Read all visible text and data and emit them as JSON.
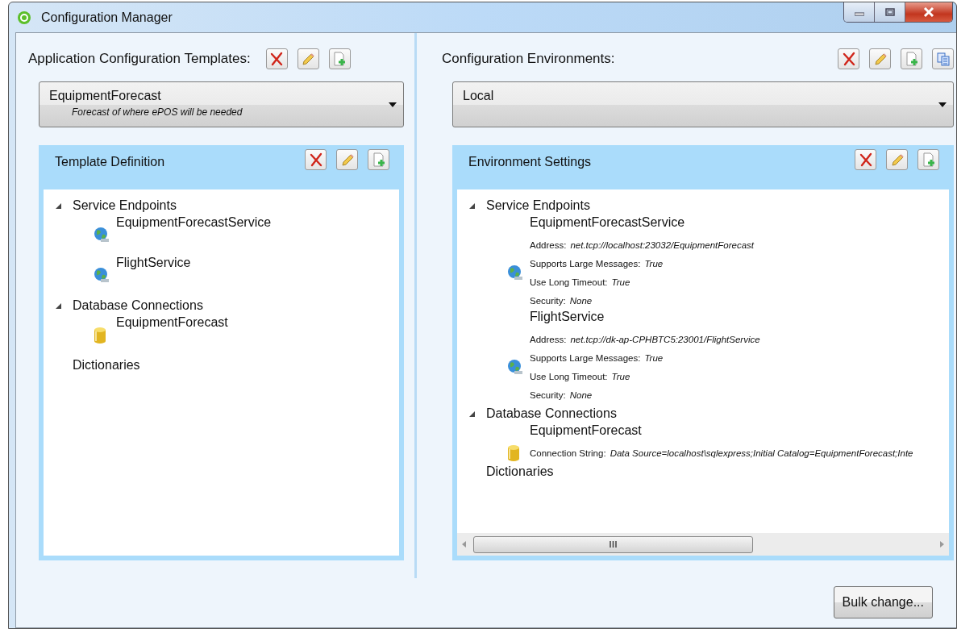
{
  "window": {
    "title": "Configuration Manager"
  },
  "templates": {
    "label": "Application Configuration Templates:",
    "actions": [
      {
        "kind": "delete"
      },
      {
        "kind": "edit"
      },
      {
        "kind": "add"
      }
    ],
    "dropdown": {
      "value": "EquipmentForecast",
      "description": "Forecast of where ePOS will be needed"
    },
    "panel": {
      "title": "Template Definition",
      "actions": [
        {
          "kind": "delete"
        },
        {
          "kind": "edit"
        },
        {
          "kind": "add"
        }
      ],
      "tree": [
        {
          "label": "Service Endpoints",
          "kind": "folder",
          "expanded": true,
          "children": [
            {
              "label": "EquipmentForecastService",
              "kind": "service"
            },
            {
              "label": "FlightService",
              "kind": "service"
            }
          ]
        },
        {
          "label": "Database Connections",
          "kind": "folder",
          "expanded": true,
          "children": [
            {
              "label": "EquipmentForecast",
              "kind": "database"
            }
          ]
        },
        {
          "label": "Dictionaries",
          "kind": "empty"
        }
      ]
    }
  },
  "environments": {
    "label": "Configuration Environments:",
    "actions": [
      {
        "kind": "delete"
      },
      {
        "kind": "edit"
      },
      {
        "kind": "add"
      },
      {
        "kind": "copy"
      }
    ],
    "dropdown": {
      "value": "Local"
    },
    "panel": {
      "title": "Environment Settings",
      "actions": [
        {
          "kind": "delete"
        },
        {
          "kind": "edit"
        },
        {
          "kind": "add"
        }
      ],
      "tree": [
        {
          "label": "Service Endpoints",
          "kind": "folder",
          "expanded": true,
          "children": [
            {
              "label": "EquipmentForecastService",
              "kind": "service",
              "properties": [
                {
                  "label": "Address:",
                  "value": "net.tcp://localhost:23032/EquipmentForecast"
                },
                {
                  "label": "Supports Large Messages:",
                  "value": "True"
                },
                {
                  "label": "Use Long Timeout:",
                  "value": "True"
                },
                {
                  "label": "Security:",
                  "value": "None"
                }
              ]
            },
            {
              "label": "FlightService",
              "kind": "service",
              "properties": [
                {
                  "label": "Address:",
                  "value": "net.tcp://dk-ap-CPHBTC5:23001/FlightService"
                },
                {
                  "label": "Supports Large Messages:",
                  "value": "True"
                },
                {
                  "label": "Use Long Timeout:",
                  "value": "True"
                },
                {
                  "label": "Security:",
                  "value": "None"
                }
              ]
            }
          ]
        },
        {
          "label": "Database Connections",
          "kind": "folder",
          "expanded": true,
          "children": [
            {
              "label": "EquipmentForecast",
              "kind": "database",
              "properties": [
                {
                  "label": "Connection String:",
                  "value": "Data Source=localhost\\sqlexpress;Initial Catalog=EquipmentForecast;Inte"
                }
              ]
            }
          ]
        },
        {
          "label": "Dictionaries",
          "kind": "empty"
        }
      ]
    }
  },
  "footer": {
    "button": "Bulk change..."
  }
}
